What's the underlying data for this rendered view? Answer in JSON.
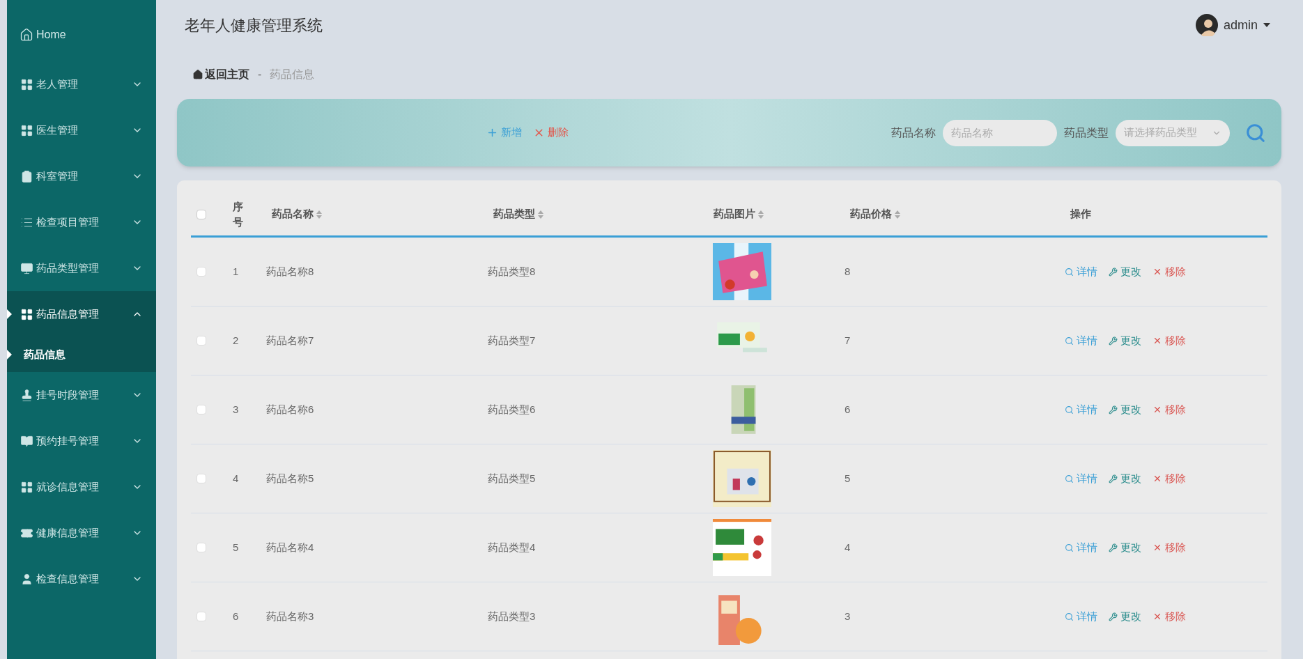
{
  "sidebar": {
    "home": "Home",
    "items": [
      {
        "label": "老人管理",
        "expanded": false
      },
      {
        "label": "医生管理",
        "expanded": false
      },
      {
        "label": "科室管理",
        "expanded": false
      },
      {
        "label": "检查项目管理",
        "expanded": false
      },
      {
        "label": "药品类型管理",
        "expanded": false
      },
      {
        "label": "药品信息管理",
        "expanded": true,
        "children": [
          {
            "label": "药品信息",
            "selected": true
          }
        ]
      },
      {
        "label": "挂号时段管理",
        "expanded": false
      },
      {
        "label": "预约挂号管理",
        "expanded": false
      },
      {
        "label": "就诊信息管理",
        "expanded": false
      },
      {
        "label": "健康信息管理",
        "expanded": false
      },
      {
        "label": "检查信息管理",
        "expanded": false
      }
    ]
  },
  "header": {
    "title": "老年人健康管理系统",
    "user": "admin"
  },
  "breadcrumb": {
    "home": "返回主页",
    "separator": "-",
    "current": "药品信息"
  },
  "toolbar": {
    "add": "新增",
    "delete": "删除",
    "name_label": "药品名称",
    "name_placeholder": "药品名称",
    "type_label": "药品类型",
    "type_placeholder": "请选择药品类型"
  },
  "table": {
    "select_all_checked": false,
    "columns": [
      {
        "label": "序号",
        "sortable": false
      },
      {
        "label": "药品名称",
        "sortable": true
      },
      {
        "label": "药品类型",
        "sortable": true
      },
      {
        "label": "药品图片",
        "sortable": true
      },
      {
        "label": "药品价格",
        "sortable": true
      },
      {
        "label": "操作",
        "sortable": false
      }
    ],
    "rows": [
      {
        "checked": false,
        "index": "1",
        "name": "药品名称8",
        "type": "药品类型8",
        "price": "8",
        "actions": [
          "详情",
          "更改",
          "移除"
        ]
      },
      {
        "checked": false,
        "index": "2",
        "name": "药品名称7",
        "type": "药品类型7",
        "price": "7",
        "actions": [
          "详情",
          "更改",
          "移除"
        ]
      },
      {
        "checked": false,
        "index": "3",
        "name": "药品名称6",
        "type": "药品类型6",
        "price": "6",
        "actions": [
          "详情",
          "更改",
          "移除"
        ]
      },
      {
        "checked": false,
        "index": "4",
        "name": "药品名称5",
        "type": "药品类型5",
        "price": "5",
        "actions": [
          "详情",
          "更改",
          "移除"
        ]
      },
      {
        "checked": false,
        "index": "5",
        "name": "药品名称4",
        "type": "药品类型4",
        "price": "4",
        "actions": [
          "详情",
          "更改",
          "移除"
        ]
      },
      {
        "checked": false,
        "index": "6",
        "name": "药品名称3",
        "type": "药品类型3",
        "price": "3",
        "actions": [
          "详情",
          "更改",
          "移除"
        ]
      }
    ]
  }
}
